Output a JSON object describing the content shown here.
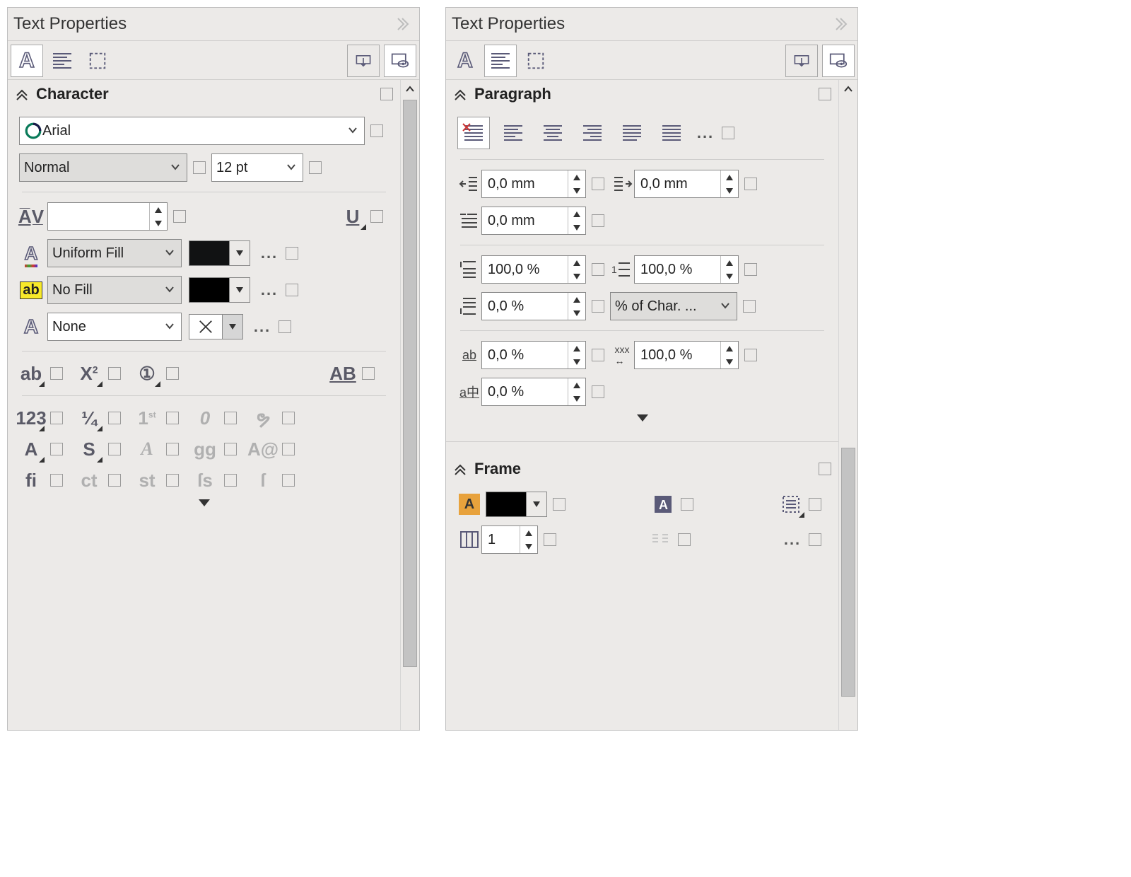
{
  "panelA": {
    "title": "Text Properties",
    "section_character": "Character",
    "font_family": "Arial",
    "font_style": "Normal",
    "font_size": "12 pt",
    "kerning": "",
    "fill_mode": "Uniform Fill",
    "bg_mode": "No Fill",
    "outline_mode": "None",
    "more": "..."
  },
  "panelB": {
    "title": "Text Properties",
    "section_paragraph": "Paragraph",
    "section_frame": "Frame",
    "indent_left": "0,0 mm",
    "indent_right": "0,0 mm",
    "indent_first": "0,0 mm",
    "before_pct": "100,0 %",
    "line_pct": "100,0 %",
    "after_pct": "0,0 %",
    "line_unit": "% of Char. ...",
    "char_space": "0,0 %",
    "word_space": "100,0 %",
    "lang_space": "0,0 %",
    "columns": "1",
    "more": "..."
  }
}
